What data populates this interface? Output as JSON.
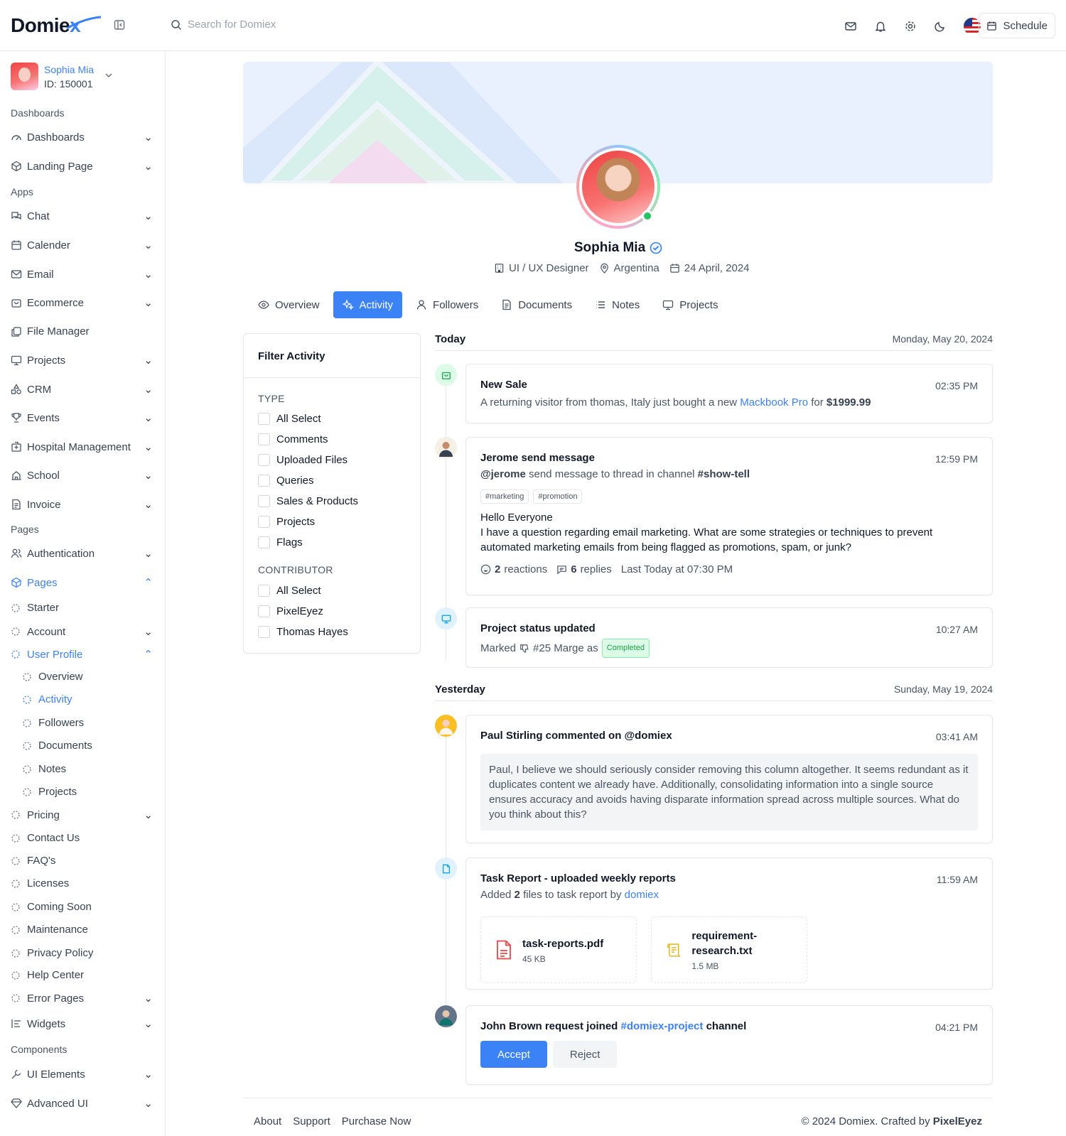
{
  "topbar": {
    "logo_main": "Domie",
    "logo_x": "x",
    "search_placeholder": "Search for Domiex",
    "schedule_label": "Schedule"
  },
  "sidebar": {
    "user_name": "Sophia Mia",
    "user_id": "ID: 150001",
    "sections": [
      "Dashboards",
      "Apps",
      "Pages",
      "Components"
    ],
    "items": {
      "dashboards": "Dashboards",
      "landing": "Landing Page",
      "chat": "Chat",
      "calender": "Calender",
      "email": "Email",
      "ecommerce": "Ecommerce",
      "file_manager": "File Manager",
      "projects": "Projects",
      "crm": "CRM",
      "events": "Events",
      "hospital": "Hospital Management",
      "school": "School",
      "invoice": "Invoice",
      "authentication": "Authentication",
      "pages": "Pages",
      "starter": "Starter",
      "account": "Account",
      "user_profile": "User Profile",
      "up_overview": "Overview",
      "up_activity": "Activity",
      "up_followers": "Followers",
      "up_documents": "Documents",
      "up_notes": "Notes",
      "up_projects": "Projects",
      "pricing": "Pricing",
      "contact": "Contact Us",
      "faq": "FAQ's",
      "licenses": "Licenses",
      "coming_soon": "Coming Soon",
      "maintenance": "Maintenance",
      "privacy": "Privacy Policy",
      "help": "Help Center",
      "error": "Error Pages",
      "widgets": "Widgets",
      "ui_elements": "UI Elements",
      "advanced_ui": "Advanced UI"
    }
  },
  "profile": {
    "name": "Sophia Mia",
    "role": "UI / UX Designer",
    "location": "Argentina",
    "date": "24 April, 2024"
  },
  "tabs": [
    "Overview",
    "Activity",
    "Followers",
    "Documents",
    "Notes",
    "Projects"
  ],
  "filter": {
    "title": "Filter Activity",
    "type_label": "TYPE",
    "type_options": [
      "All Select",
      "Comments",
      "Uploaded Files",
      "Queries",
      "Sales & Products",
      "Projects",
      "Flags"
    ],
    "contributor_label": "CONTRIBUTOR",
    "contributor_options": [
      "All Select",
      "PixelEyez",
      "Thomas Hayes"
    ]
  },
  "timeline": {
    "today": {
      "label": "Today",
      "date": "Monday, May 20, 2024"
    },
    "yesterday": {
      "label": "Yesterday",
      "date": "Sunday, May 19, 2024"
    },
    "sale": {
      "title": "New Sale",
      "time": "02:35 PM",
      "text_pre": "A returning visitor from thomas, Italy just bought a new",
      "product": "Mackbook Pro",
      "text_mid": "for",
      "price": "$1999.99"
    },
    "message": {
      "title": "Jerome send message",
      "time": "12:59 PM",
      "handle": "@jerome",
      "text_mid": "send message to thread in channel",
      "channel": "#show-tell",
      "tags": [
        "#marketing",
        "#promotion"
      ],
      "greeting": "Hello Everyone",
      "body": "I have a question regarding email marketing. What are some strategies or techniques to prevent automated marketing emails from being flagged as promotions, spam, or junk?",
      "reactions_count": "2",
      "reactions_label": "reactions",
      "replies_count": "6",
      "replies_label": "replies",
      "last": "Last Today at 07:30 PM"
    },
    "project": {
      "title": "Project status updated",
      "time": "10:27 AM",
      "text_pre": "Marked",
      "ref": "#25 Marge as",
      "status": "Completed"
    },
    "comment": {
      "title": "Paul Stirling commented on @domiex",
      "time": "03:41 AM",
      "quote": "Paul, I believe we should seriously consider removing this column altogether. It seems redundant as it duplicates content we already have. Additionally, consolidating information into a single source ensures accuracy and avoids having disparate information spread across multiple sources. What do you think about this?"
    },
    "task": {
      "title": "Task Report - uploaded weekly reports",
      "time": "11:59 AM",
      "text_pre": "Added",
      "count": "2",
      "text_mid": "files to task report by",
      "by": "domiex",
      "files": [
        {
          "name": "task-reports.pdf",
          "size": "45 KB"
        },
        {
          "name": "requirement-research.txt",
          "size": "1.5 MB"
        }
      ]
    },
    "join": {
      "title_pre": "John Brown request joined",
      "channel": "#domiex-project",
      "title_post": "channel",
      "time": "04:21 PM",
      "accept": "Accept",
      "reject": "Reject"
    }
  },
  "footer": {
    "links": [
      "About",
      "Support",
      "Purchase Now"
    ],
    "copyright": "© 2024 Domiex. Crafted by",
    "brand": "PixelEyez"
  },
  "colors": {
    "accent": "#3b82f6",
    "success": "#22c55e"
  }
}
